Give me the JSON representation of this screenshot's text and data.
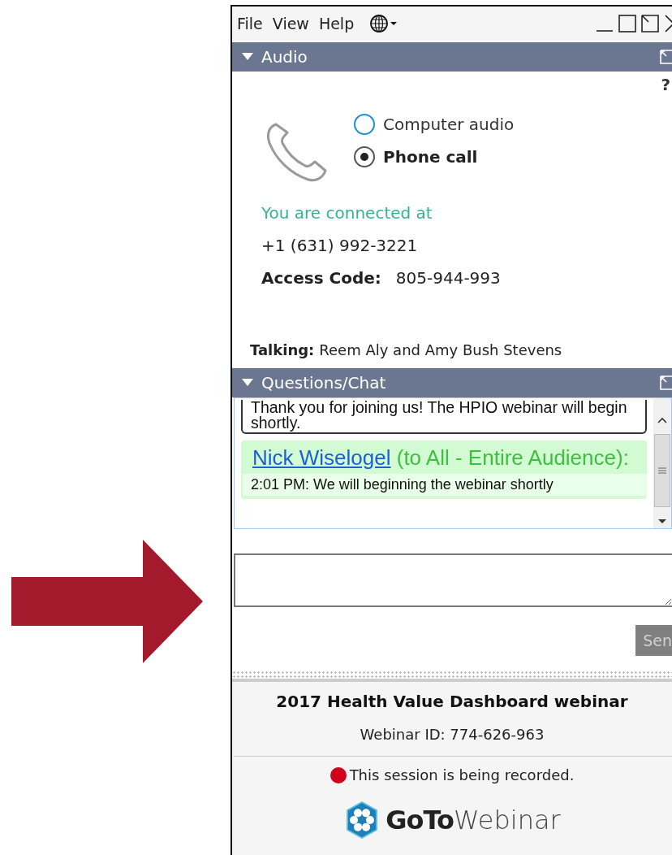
{
  "menu": {
    "items": [
      "File",
      "View",
      "Help"
    ]
  },
  "audio": {
    "title": "Audio",
    "expanded": true,
    "help": "?",
    "options": [
      {
        "label": "Computer audio",
        "selected": false
      },
      {
        "label": "Phone call",
        "selected": true
      }
    ],
    "status": "You are connected at",
    "phone": "+1 (631) 992-3221",
    "access_code": {
      "label": "Access Code:",
      "value": "805-944-993"
    },
    "talking": {
      "label": "Talking:",
      "value": "Reem Aly and Amy Bush Stevens"
    }
  },
  "chat": {
    "title": "Questions/Chat",
    "expanded": true,
    "messages": [
      {
        "kind": "system",
        "text": "Thank you for joining us! The HPIO webinar will begin shortly."
      },
      {
        "kind": "chat",
        "sender": "Nick Wiselogel",
        "audience": "(to All - Entire Audience):",
        "text": "2:01 PM: We will beginning the webinar shortly"
      }
    ],
    "send": "Sen"
  },
  "footer": {
    "title": "2017 Health Value Dashboard webinar",
    "webinar_id": "Webinar ID: 774-626-963",
    "recording": {
      "text": "This session is being recorded.",
      "on": true
    },
    "logo": {
      "bold": "GoTo",
      "light": "Webinar"
    }
  }
}
